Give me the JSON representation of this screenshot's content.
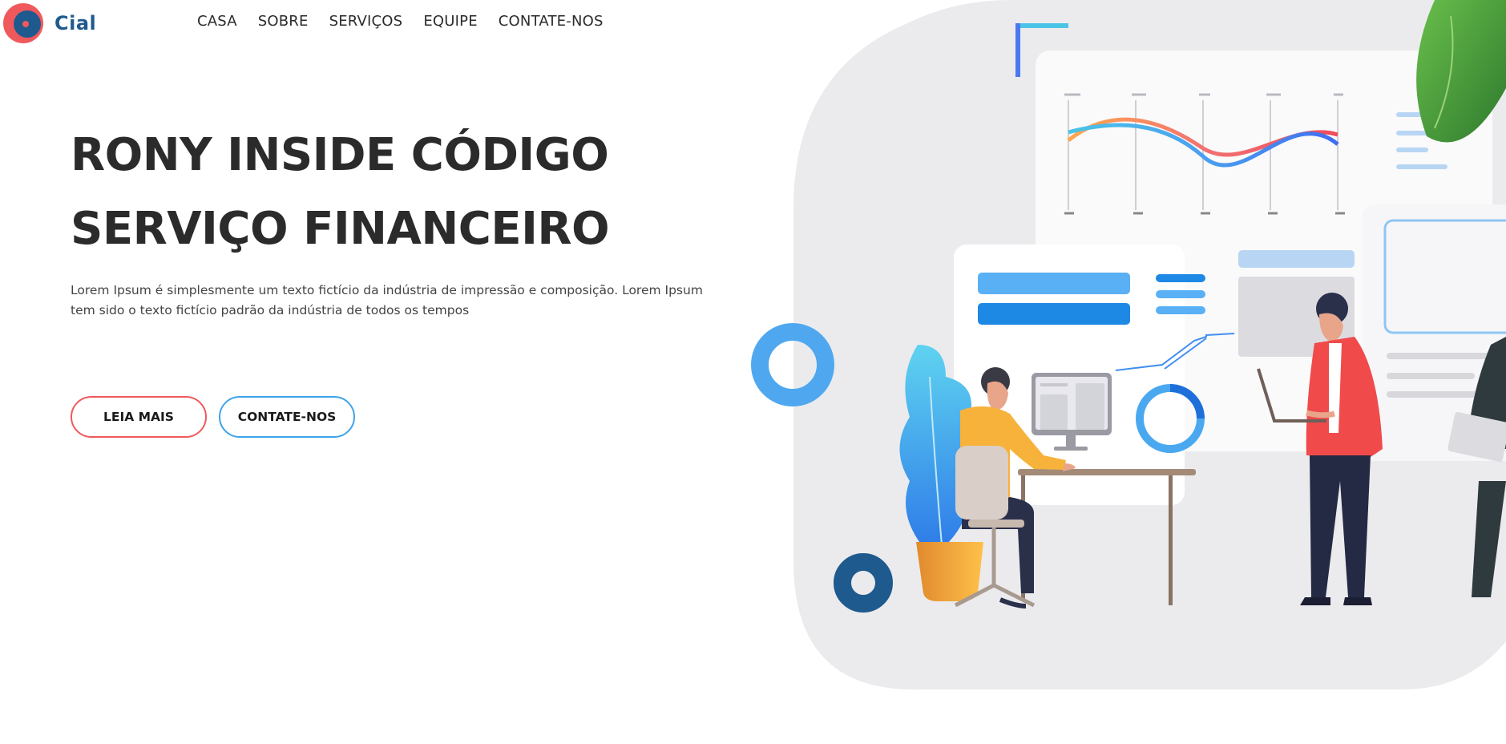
{
  "brand": {
    "name": "Cial"
  },
  "nav": {
    "items": [
      "CASA",
      "SOBRE",
      "SERVIÇOS",
      "EQUIPE",
      "CONTATE-NOS"
    ]
  },
  "hero": {
    "title_line1": "RONY INSIDE CÓDIGO",
    "title_line2": "SERVIÇO FINANCEIRO",
    "description": "Lorem Ipsum é simplesmente um texto fictício da indústria de impressão e composição. Lorem Ipsum tem sido o texto fictício padrão da indústria de todos os tempos",
    "button_read_more": "LEIA MAIS",
    "button_contact": "CONTATE-NOS"
  },
  "colors": {
    "brand_blue": "#1f5a8e",
    "accent_red": "#f0595b",
    "accent_blue": "#3fa3ea",
    "text_dark": "#2b2b2b",
    "blob_gray": "#ebebee"
  },
  "icons": [
    "logo-icon",
    "illustration-office-team"
  ]
}
